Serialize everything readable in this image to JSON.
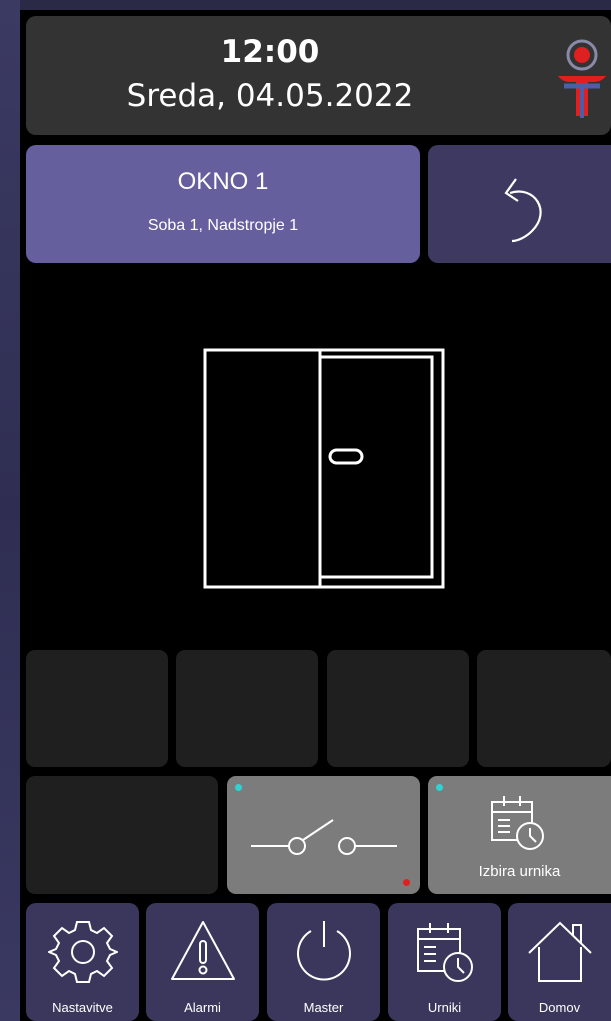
{
  "header": {
    "time": "12:00",
    "date": "Sreda, 04.05.2022"
  },
  "device": {
    "name": "OKNO 1",
    "location": "Soba 1, Nadstropje 1"
  },
  "controls": {
    "schedule_label": "Izbira urnika"
  },
  "nav": [
    {
      "label": "Nastavitve",
      "icon": "gear-icon"
    },
    {
      "label": "Alarmi",
      "icon": "warning-icon"
    },
    {
      "label": "Master",
      "icon": "power-icon"
    },
    {
      "label": "Urniki",
      "icon": "calendar-clock-icon"
    },
    {
      "label": "Domov",
      "icon": "home-icon"
    }
  ],
  "colors": {
    "accent": "#655f9e",
    "nav_bg": "#3b375c",
    "status_cyan": "#2fd3d3",
    "status_red": "#e02020"
  }
}
